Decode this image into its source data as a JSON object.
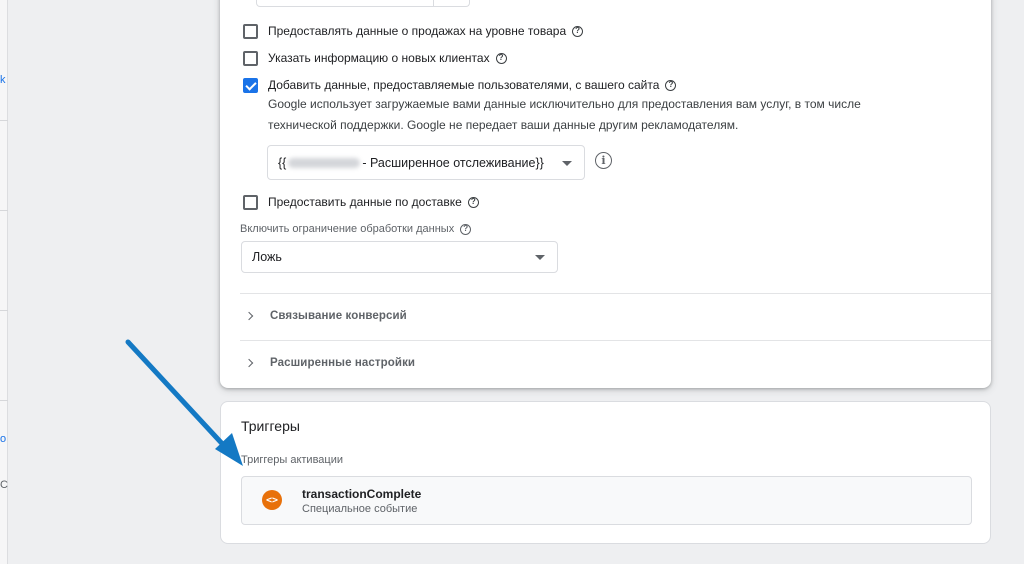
{
  "colors": {
    "accent": "#1a73e8",
    "arrow": "#1479c4",
    "trigger_icon": "#e8710a",
    "background": "#eeeff1"
  },
  "left_strip": {
    "glyphs": [
      "k",
      "o",
      "C"
    ]
  },
  "options": [
    {
      "label": "Предоставлять данные о продажах на уровне товара",
      "checked": false,
      "help_icon": "help-circle-icon"
    },
    {
      "label": "Указать информацию о новых клиентах",
      "checked": false,
      "help_icon": "help-circle-icon"
    },
    {
      "label": "Добавить данные, предоставляемые пользователями, с вашего сайта",
      "checked": true,
      "help_icon": "help-circle-icon"
    }
  ],
  "user_data_description": "Google использует загружаемые вами данные исключительно для предоставления вам услуг, в том числе технической поддержки. Google не передает ваши данные другим рекламодателям.",
  "variable_select": {
    "prefix": "{{",
    "suffix": "- Расширенное отслеживание}}",
    "icon": "info-icon",
    "info_glyph": "i"
  },
  "delivery_option": {
    "label": "Предоставить данные по доставке",
    "checked": false
  },
  "restricted_processing": {
    "label": "Включить ограничение обработки данных",
    "value": "Ложь"
  },
  "sections": [
    {
      "label": "Связывание конверсий",
      "icon": "chevron-right-icon"
    },
    {
      "label": "Расширенные настройки",
      "icon": "chevron-right-icon"
    }
  ],
  "triggers": {
    "title": "Триггеры",
    "subtitle": "Триггеры активации",
    "items": [
      {
        "name": "transactionComplete",
        "type": "Специальное событие",
        "icon": "custom-event-icon",
        "icon_glyph": "<>"
      }
    ]
  },
  "help_glyph": "?"
}
